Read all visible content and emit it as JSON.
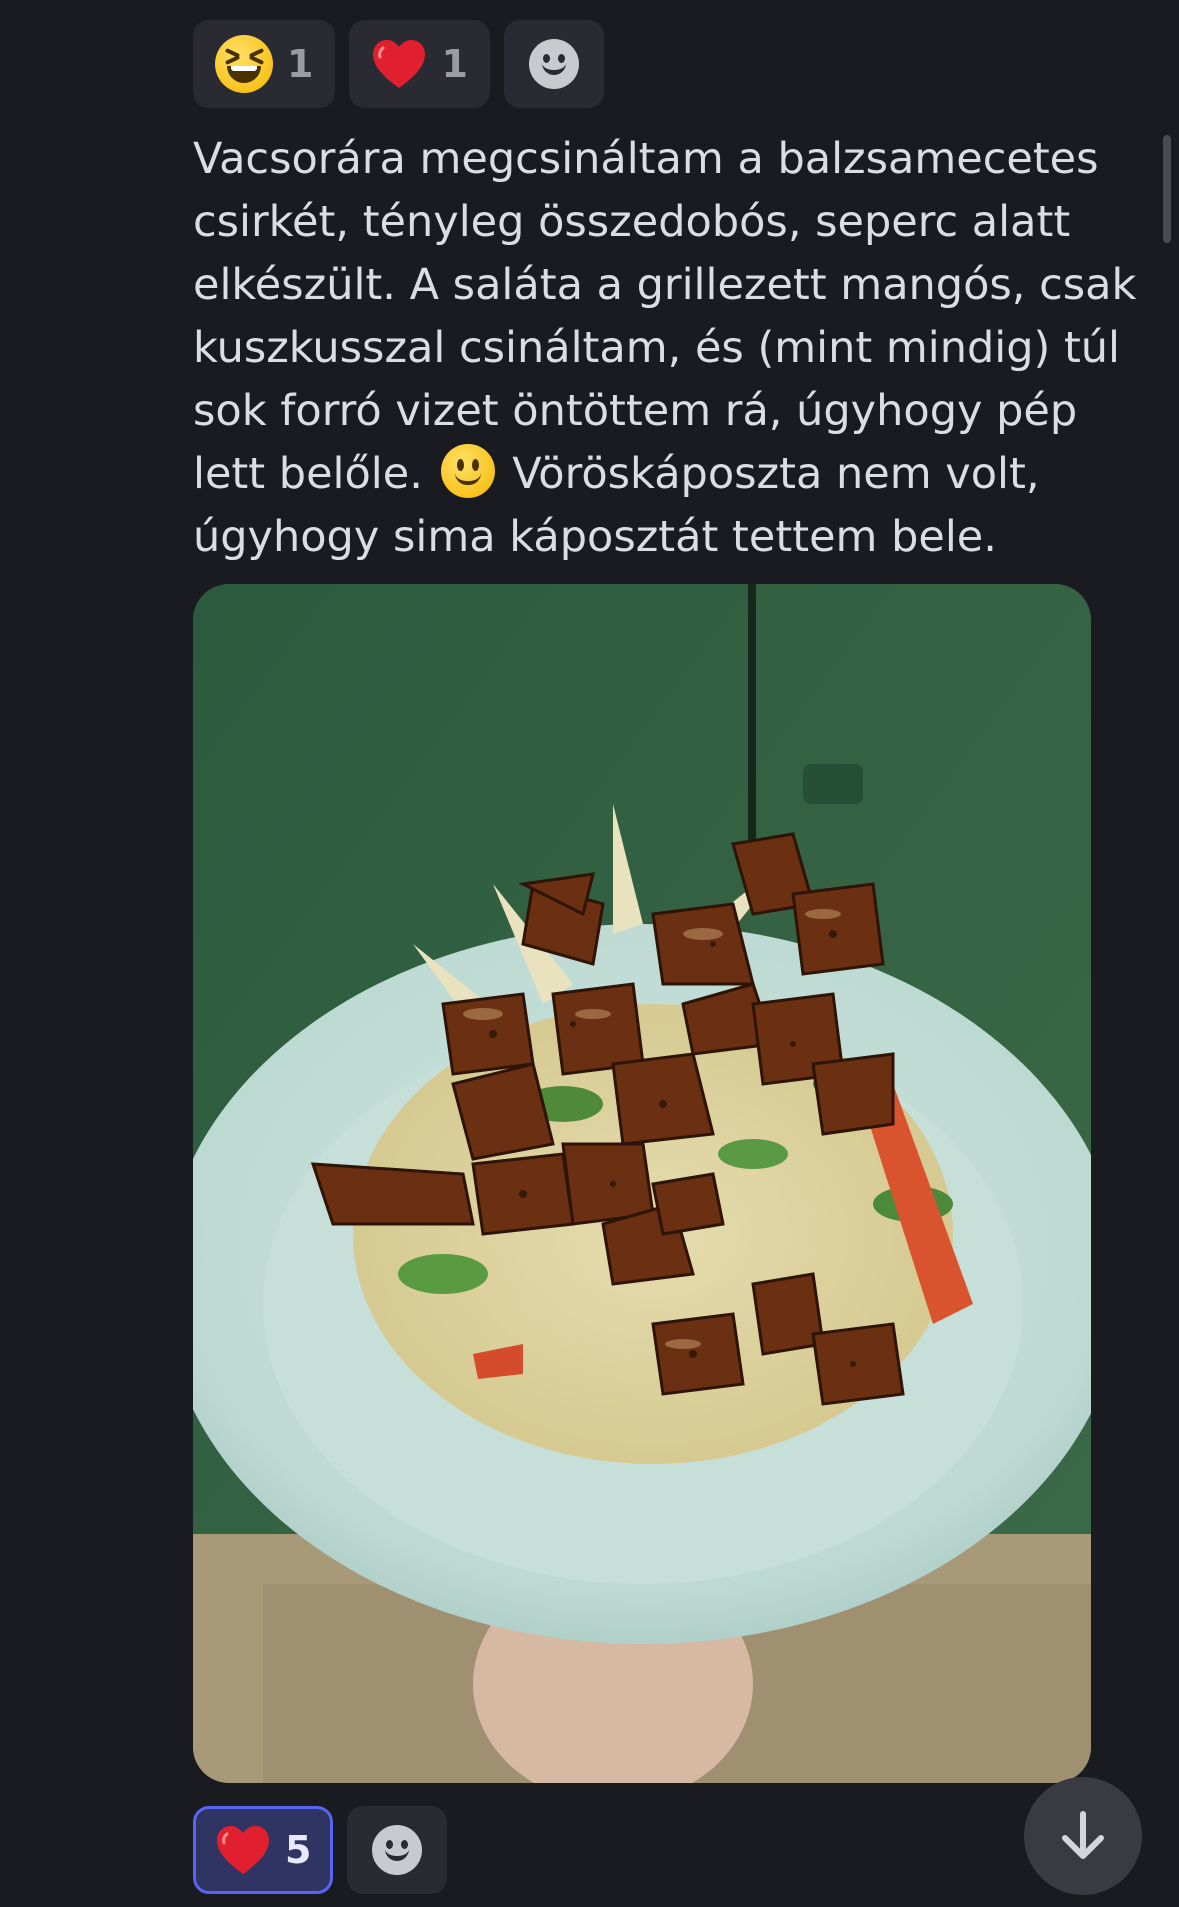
{
  "top_reactions": [
    {
      "emoji": "grinning-squinting-face-icon",
      "count": "1"
    },
    {
      "emoji": "red-heart-icon",
      "count": "1"
    }
  ],
  "message": {
    "text_part1": "Vacsorára megcsináltam a balzsamecetes csirkét, tényleg összedobós, seperc alatt elkészült. A saláta a grillezett mangós, csak kuszkusszal csináltam, és (mint mindig) túl sok forró vizet öntöttem rá, úgyhogy pép lett belőle. ",
    "text_part2": " Vöröskáposzta nem volt, úgyhogy sima káposztát tettem bele.",
    "inline_emoji": "slightly-smiling-face-icon"
  },
  "bottom_reactions": [
    {
      "emoji": "red-heart-icon",
      "count": "5",
      "active": true
    }
  ],
  "colors": {
    "background": "#1a1b20",
    "pill": "#2a2b32",
    "active_pill": "#2f3462",
    "active_border": "#5865f2",
    "text": "#dcdde1"
  }
}
